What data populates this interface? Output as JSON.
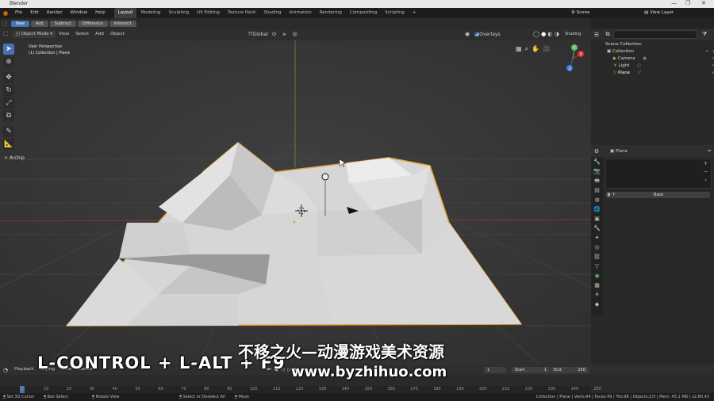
{
  "window": {
    "title": "Blender",
    "controls": [
      "—",
      "❐",
      "✕"
    ]
  },
  "menu": [
    "File",
    "Edit",
    "Render",
    "Window",
    "Help"
  ],
  "workspaces": {
    "active": "Layout",
    "tabs": [
      "Layout",
      "Modeling",
      "Sculpting",
      "UV Editing",
      "Texture Paint",
      "Shading",
      "Animation",
      "Rendering",
      "Compositing",
      "Scripting"
    ]
  },
  "top_right": {
    "scene": "Scene",
    "view_layer": "View Layer"
  },
  "tool_settings": {
    "modes": [
      "New",
      "Add",
      "Subtract",
      "Difference",
      "Intersect"
    ],
    "active": "New"
  },
  "viewport_header": {
    "mode": "Object Mode",
    "menus": [
      "View",
      "Select",
      "Add",
      "Object"
    ],
    "transform": "Global",
    "overlays": "Overlays",
    "shading": "Shading"
  },
  "viewport": {
    "view_name": "User Perspective",
    "collection_info": "(1) Collection | Plane",
    "addon_tab": "Archip",
    "gizmo_axes": [
      "X",
      "Y",
      "Z"
    ]
  },
  "outliner": {
    "search_placeholder": "",
    "items": [
      {
        "label": "Scene Collection",
        "indent": 0
      },
      {
        "label": "Collection",
        "indent": 1
      },
      {
        "label": "Camera",
        "indent": 2
      },
      {
        "label": "Light",
        "indent": 2
      },
      {
        "label": "Plane",
        "indent": 2
      }
    ]
  },
  "properties": {
    "object": "Plane",
    "uv_button": "Base"
  },
  "timeline": {
    "menus": [
      "Playback",
      "Keying",
      "View",
      "Marker"
    ],
    "current_frame": "1",
    "start_label": "Start",
    "start": "1",
    "end_label": "End",
    "end": "250",
    "ruler": [
      "0",
      "10",
      "20",
      "30",
      "40",
      "50",
      "60",
      "70",
      "80",
      "90",
      "100",
      "110",
      "120",
      "130",
      "140",
      "150",
      "160",
      "170",
      "180",
      "190",
      "200",
      "210",
      "220",
      "230",
      "240",
      "250"
    ]
  },
  "status": {
    "left": [
      "Set 3D Cursor",
      "Box Select",
      "Rotate View",
      "Select or Deselect All",
      "Move"
    ],
    "right": "Collection | Plane | Verts:64 | Faces:49 | Tris:98 | Objects:1/3 | Mem: 43.1 MB | v2.80.43"
  },
  "overlay_text": {
    "shortcut": "L-CONTROL + L-ALT + F9",
    "watermark_cn": "不移之火—动漫游戏美术资源",
    "watermark_url": "www.byzhihuo.com"
  },
  "colors": {
    "accent": "#4772b3",
    "selection_outline": "#e8a33c",
    "mesh": "#d4d4d4"
  }
}
